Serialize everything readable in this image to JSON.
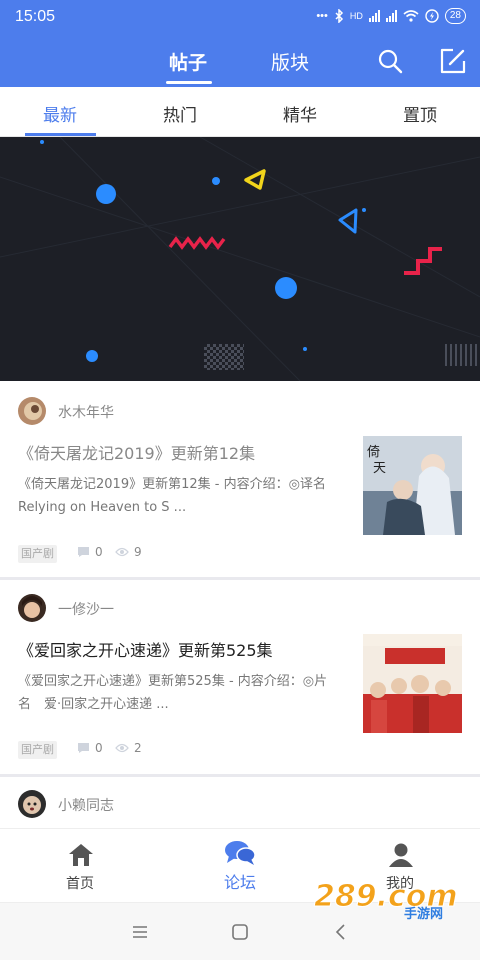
{
  "status": {
    "time": "15:05",
    "network": "HD",
    "battery": "28"
  },
  "header": {
    "tabs": [
      {
        "label": "帖子",
        "active": true
      },
      {
        "label": "版块",
        "active": false
      }
    ],
    "icons": [
      "search-icon",
      "compose-icon"
    ]
  },
  "subtabs": [
    {
      "label": "最新",
      "active": true
    },
    {
      "label": "热门",
      "active": false
    },
    {
      "label": "精华",
      "active": false
    },
    {
      "label": "置顶",
      "active": false
    }
  ],
  "posts": [
    {
      "author": "水木年华",
      "title": "《倚天屠龙记2019》更新第12集",
      "title_read": true,
      "excerpt": "《倚天屠龙记2019》更新第12集 - 内容介绍：◎译名　Relying on Heaven to S ...",
      "tag": "国产剧",
      "comments": "0",
      "views": "9"
    },
    {
      "author": "一修沙一",
      "title": "《爱回家之开心速递》更新第525集",
      "title_read": false,
      "excerpt": "《爱回家之开心速递》更新第525集 - 内容介绍：◎片　　名　爱·回家之开心速递 ...",
      "tag": "国产剧",
      "comments": "0",
      "views": "2"
    },
    {
      "author": "小赖同志"
    }
  ],
  "bottomnav": [
    {
      "label": "首页",
      "icon": "home-icon",
      "active": false
    },
    {
      "label": "论坛",
      "icon": "forum-icon",
      "active": true
    },
    {
      "label": "我的",
      "icon": "profile-icon",
      "active": false
    }
  ],
  "watermark": {
    "brand": "289.com",
    "sub": "手游网"
  },
  "colors": {
    "accent": "#4d7dec",
    "banner_bg": "#1d1f26",
    "pink": "#e8234a",
    "yellow": "#f1d41b",
    "blue_dot": "#2b8cff"
  }
}
